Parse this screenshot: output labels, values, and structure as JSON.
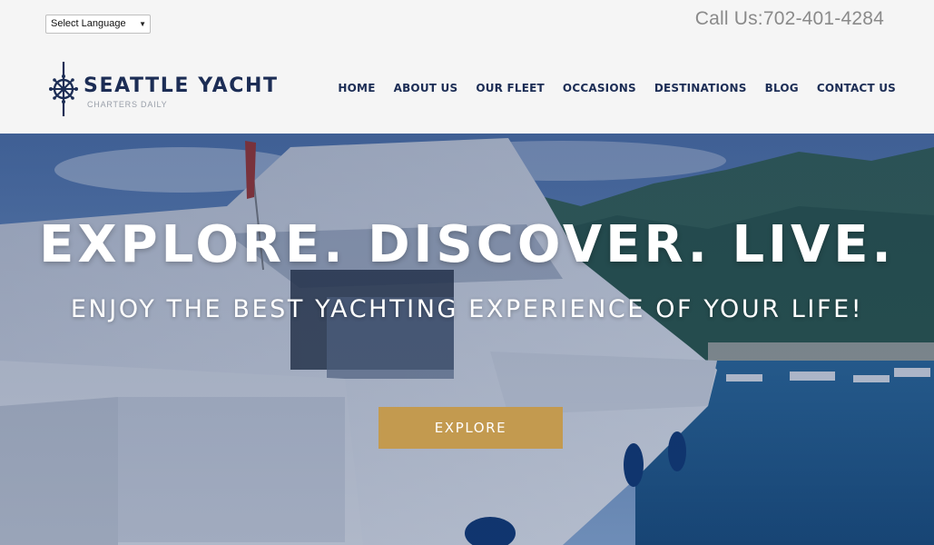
{
  "language_select": {
    "selected": "Select Language"
  },
  "phone": {
    "text": "Call Us:702-401-4284"
  },
  "brand": {
    "title": "SEATTLE YACHT",
    "subtitle": "CHARTERS DAILY"
  },
  "nav": {
    "items": [
      {
        "label": "HOME"
      },
      {
        "label": "ABOUT US"
      },
      {
        "label": "OUR FLEET"
      },
      {
        "label": "OCCASIONS"
      },
      {
        "label": "DESTINATIONS"
      },
      {
        "label": "BLOG"
      },
      {
        "label": "CONTACT US"
      }
    ]
  },
  "hero": {
    "headline": "EXPLORE. DISCOVER. LIVE.",
    "subheadline": "ENJOY THE BEST YACHTING EXPERIENCE OF YOUR LIFE!",
    "cta_label": "EXPLORE"
  },
  "colors": {
    "brand_navy": "#1c2d55",
    "cta_gold": "#c39a4f",
    "header_bg": "#f5f5f5",
    "phone_text": "#8a8a8a"
  }
}
